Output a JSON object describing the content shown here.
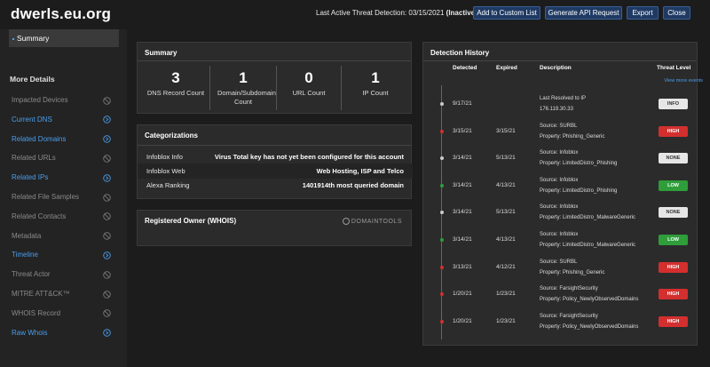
{
  "header": {
    "domain": "dwerls.eu.org",
    "last_active_label": "Last Active Threat Detection:",
    "last_active_date": "03/15/2021",
    "last_active_status": "(Inactive)",
    "buttons": [
      "Add to Custom List",
      "Generate API Request",
      "Export",
      "Close"
    ]
  },
  "sidebar": {
    "summary_label": "Summary",
    "more_details_label": "More Details",
    "items": [
      {
        "label": "Impacted Devices",
        "enabled": false
      },
      {
        "label": "Current DNS",
        "enabled": true
      },
      {
        "label": "Related Domains",
        "enabled": true
      },
      {
        "label": "Related URLs",
        "enabled": false
      },
      {
        "label": "Related IPs",
        "enabled": true
      },
      {
        "label": "Related File Samples",
        "enabled": false
      },
      {
        "label": "Related Contacts",
        "enabled": false
      },
      {
        "label": "Metadata",
        "enabled": false
      },
      {
        "label": "Timeline",
        "enabled": true
      },
      {
        "label": "Threat Actor",
        "enabled": false
      },
      {
        "label": "MITRE ATT&CK™",
        "enabled": false
      },
      {
        "label": "WHOIS Record",
        "enabled": false
      },
      {
        "label": "Raw Whois",
        "enabled": true
      }
    ]
  },
  "summary": {
    "title": "Summary",
    "counts": [
      {
        "value": "3",
        "label": "DNS Record Count"
      },
      {
        "value": "1",
        "label": "Domain/Subdomain Count"
      },
      {
        "value": "0",
        "label": "URL Count"
      },
      {
        "value": "1",
        "label": "IP Count"
      }
    ]
  },
  "categorizations": {
    "title": "Categorizations",
    "rows": [
      {
        "key": "Infoblox Info",
        "value": "Virus Total key has not yet been configured for this account"
      },
      {
        "key": "Infoblox Web",
        "value": "Web Hosting, ISP and Telco"
      },
      {
        "key": "Alexa Ranking",
        "value": "1401914th most queried domain"
      }
    ]
  },
  "whois": {
    "title": "Registered Owner (WHOIS)",
    "logo_text": "DOMAINTOOLS"
  },
  "detection_history": {
    "title": "Detection History",
    "columns": {
      "detected": "Detected",
      "expired": "Expired",
      "description": "Description",
      "threat_level": "Threat Level"
    },
    "view_more": "View more events",
    "events": [
      {
        "detected": "9/17/21",
        "expired": "",
        "line1": "Last Resolved to IP",
        "line2": "176.119.30.33",
        "level": "INFO",
        "kind": "info",
        "dot": "#cccccc"
      },
      {
        "detected": "3/15/21",
        "expired": "3/15/21",
        "line1": "Source: SURBL",
        "line2": "Property: Phishing_Generic",
        "level": "HIGH",
        "kind": "high",
        "dot": "#d32f2f"
      },
      {
        "detected": "3/14/21",
        "expired": "5/13/21",
        "line1": "Source: Infoblox",
        "line2": "Property: LimitedDistro_Phishing",
        "level": "NONE",
        "kind": "none",
        "dot": "#cccccc"
      },
      {
        "detected": "3/14/21",
        "expired": "4/13/21",
        "line1": "Source: Infoblox",
        "line2": "Property: LimitedDistro_Phishing",
        "level": "LOW",
        "kind": "low",
        "dot": "#2e9d3a"
      },
      {
        "detected": "3/14/21",
        "expired": "5/13/21",
        "line1": "Source: Infoblox",
        "line2": "Property: LimitedDistro_MalwareGeneric",
        "level": "NONE",
        "kind": "none",
        "dot": "#cccccc"
      },
      {
        "detected": "3/14/21",
        "expired": "4/13/21",
        "line1": "Source: Infoblox",
        "line2": "Property: LimitedDistro_MalwareGeneric",
        "level": "LOW",
        "kind": "low",
        "dot": "#2e9d3a"
      },
      {
        "detected": "3/13/21",
        "expired": "4/12/21",
        "line1": "Source: SURBL",
        "line2": "Property: Phishing_Generic",
        "level": "HIGH",
        "kind": "high",
        "dot": "#d32f2f"
      },
      {
        "detected": "1/20/21",
        "expired": "1/23/21",
        "line1": "Source: FarsightSecurity",
        "line2": "Property: Policy_NewlyObservedDomains",
        "level": "HIGH",
        "kind": "high",
        "dot": "#d32f2f"
      },
      {
        "detected": "1/20/21",
        "expired": "1/23/21",
        "line1": "Source: FarsightSecurity",
        "line2": "Property: Policy_NewlyObservedDomains",
        "level": "HIGH",
        "kind": "high",
        "dot": "#d32f2f"
      }
    ]
  }
}
